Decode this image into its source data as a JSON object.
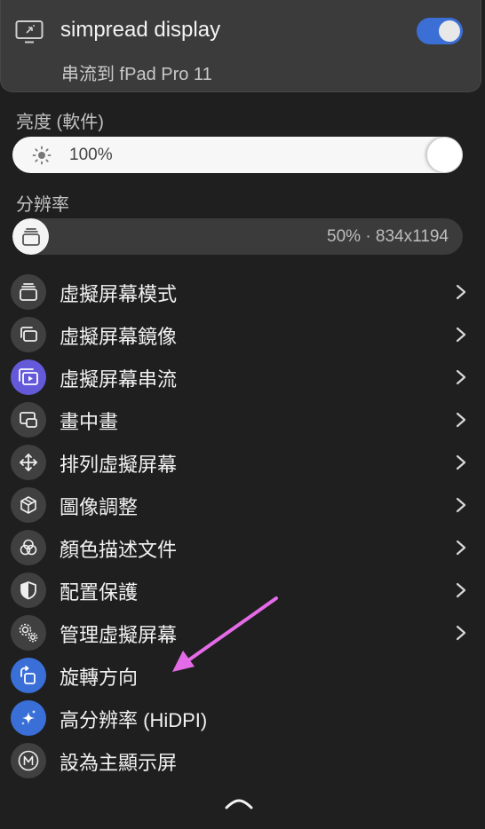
{
  "header": {
    "display_name": "simpread display",
    "stream_subtitle": "串流到 fPad Pro 11",
    "toggle_on": true,
    "toggle_color": "#3c6fd6"
  },
  "brightness": {
    "label": "亮度 (軟件)",
    "value_text": "100%",
    "value": 1.0
  },
  "resolution": {
    "label": "分辨率",
    "value_text": "50% · 834x1194",
    "value": 0.0
  },
  "menu": {
    "items": [
      {
        "label": "虛擬屏幕模式",
        "icon": "stacked-layers-icon",
        "has_submenu": true
      },
      {
        "label": "虛擬屏幕鏡像",
        "icon": "mirror-windows-icon",
        "has_submenu": true
      },
      {
        "label": "虛擬屏幕串流",
        "icon": "stream-play-icon",
        "has_submenu": true
      },
      {
        "label": "畫中畫",
        "icon": "picture-in-picture-icon",
        "has_submenu": true
      },
      {
        "label": "排列虛擬屏幕",
        "icon": "move-arrows-icon",
        "has_submenu": true
      },
      {
        "label": "圖像調整",
        "icon": "cube-icon",
        "has_submenu": true
      },
      {
        "label": "顏色描述文件",
        "icon": "color-circles-icon",
        "has_submenu": true
      },
      {
        "label": "配置保護",
        "icon": "shield-icon",
        "has_submenu": true
      },
      {
        "label": "管理虛擬屏幕",
        "icon": "gears-icon",
        "has_submenu": true
      },
      {
        "label": "旋轉方向",
        "icon": "rotate-icon",
        "has_submenu": false
      },
      {
        "label": "高分辨率 (HiDPI)",
        "icon": "sparkle-icon",
        "has_submenu": false
      },
      {
        "label": "設為主顯示屏",
        "icon": "main-display-m-icon",
        "has_submenu": false
      }
    ]
  },
  "colors": {
    "accent_blue": "#3a6fd8",
    "accent_purple": "#6459d8",
    "annotation_arrow": "#e46be8"
  }
}
